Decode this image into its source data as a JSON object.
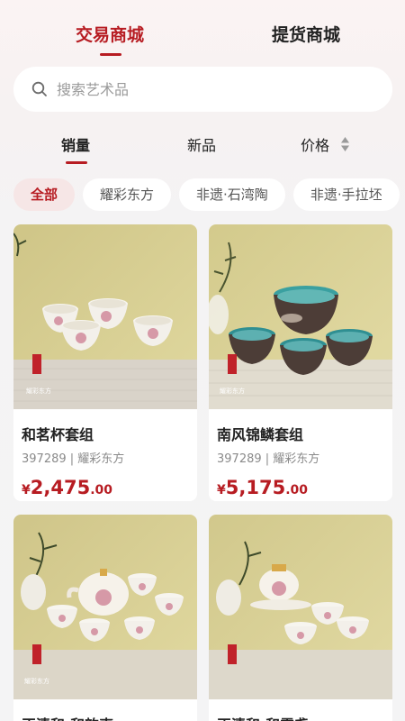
{
  "tabs": [
    {
      "label": "交易商城",
      "active": true
    },
    {
      "label": "提货商城",
      "active": false
    }
  ],
  "search": {
    "placeholder": "搜索艺术品",
    "icon": "search-icon"
  },
  "sort": [
    {
      "label": "销量",
      "active": true
    },
    {
      "label": "新品",
      "active": false
    },
    {
      "label": "价格",
      "active": false,
      "icon": "sort-arrows-icon"
    }
  ],
  "categories": [
    {
      "label": "全部",
      "active": true
    },
    {
      "label": "耀彩东方",
      "active": false
    },
    {
      "label": "非遗·石湾陶",
      "active": false
    },
    {
      "label": "非遗·手拉坯",
      "active": false
    }
  ],
  "products": [
    {
      "name": "和茗杯套组",
      "meta": "397289 | 耀彩东方",
      "currency": "¥",
      "price_int": "2,475",
      "price_dec": ".00",
      "watermark": "耀彩东方"
    },
    {
      "name": "南风锦鳞套组",
      "meta": "397289 | 耀彩东方",
      "currency": "¥",
      "price_int": "5,175",
      "price_dec": ".00",
      "watermark": "耀彩东方"
    },
    {
      "name": "正清和·和韵壶",
      "watermark": "耀彩东方"
    },
    {
      "name": "正清和·和露盏",
      "watermark": ""
    }
  ],
  "colors": {
    "accent": "#b71c22",
    "chip_active_bg": "#f6e6e6",
    "product_bg": "#d7cd8e"
  }
}
